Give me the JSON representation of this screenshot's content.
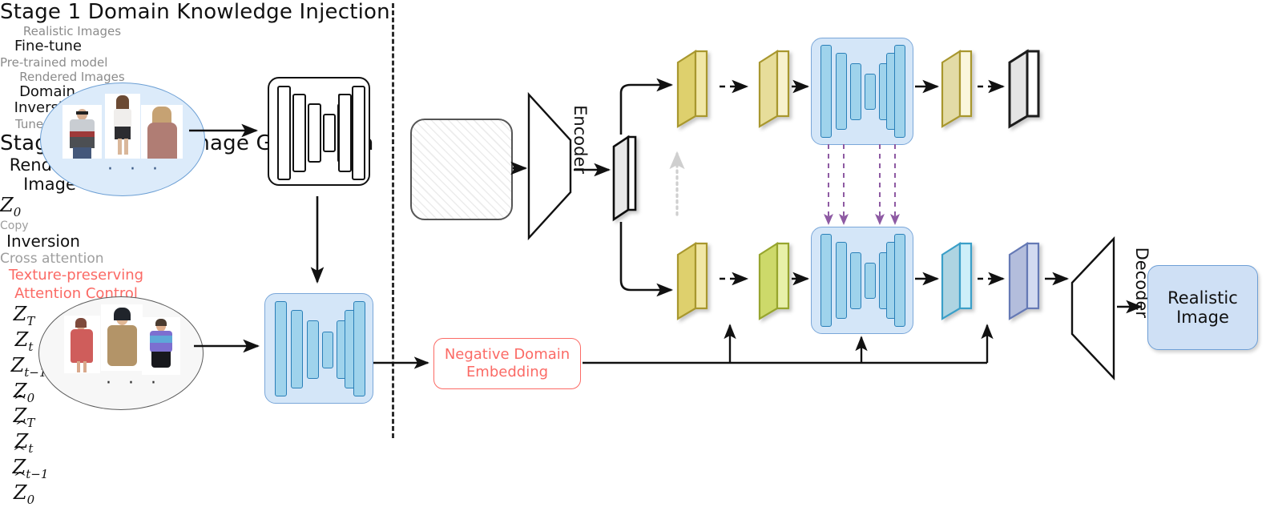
{
  "stages": {
    "stage1": {
      "title": "Stage 1 Domain Knowledge Injection",
      "source_caption": "Realistic Images",
      "source_dots": "· · ·",
      "arrow1_label": "Fine-tune",
      "model1_caption": "Pre-trained model",
      "arrow2_label_line1": "Domain",
      "arrow2_label_line2": "Inversion",
      "target_caption": "Rendered Images",
      "target_dots": "· · ·",
      "model2_caption": "Tuned model"
    },
    "stage2": {
      "title": "Stage 2 Realistic Image Generation",
      "input_box_line1": "Rendered",
      "input_box_line2": "Image",
      "encoder_label": "Encoder",
      "decoder_label": "Decoder",
      "latent_z0_label": "Z",
      "latent_z0_sub": "0",
      "copy_label": "Copy",
      "inversion_label": "Inversion",
      "negative_embedding_line1": "Negative Domain",
      "negative_embedding_line2": "Embedding",
      "cross_attention_label": "Cross attention",
      "attention_control_line1": "Texture-preserving",
      "attention_control_line2": "Attention Control",
      "output_box_line1": "Realistic",
      "output_box_line2": "Image"
    }
  },
  "top_chain": {
    "labels": [
      "Z_T",
      "Z_t",
      "Z_t-1",
      "Z_0"
    ],
    "items": [
      {
        "base": "Z",
        "sub": "T",
        "hat": false
      },
      {
        "base": "Z",
        "sub": "t",
        "hat": false
      },
      {
        "base": "Z",
        "sub": "t−1",
        "hat": false
      },
      {
        "base": "Z",
        "sub": "0",
        "hat": false
      }
    ]
  },
  "bottom_chain": {
    "labels": [
      "Ẑ_T",
      "Ẑ_t",
      "Ẑ_t-1",
      "Ẑ_0"
    ],
    "items": [
      {
        "base": "Z",
        "sub": "T",
        "hat": true
      },
      {
        "base": "Z",
        "sub": "t",
        "hat": true
      },
      {
        "base": "Z",
        "sub": "t−1",
        "hat": true
      },
      {
        "base": "Z",
        "sub": "0",
        "hat": true
      }
    ]
  },
  "colors": {
    "accent_red": "#fb6a65",
    "grey_caption": "#9e9e9e",
    "unet_blue_fill": "#d4e6f8",
    "unet_blue_bar": "#9fd3ec",
    "latent_yellow": "#e3d06a",
    "latent_pale_yellow": "#efe6a8",
    "latent_olive": "#d7e36a",
    "latent_cyan": "#a8d8e8",
    "latent_lavender": "#b4bede",
    "latent_grey": "#e2e2e2",
    "attention_purple": "#9a5fa8",
    "ellipse_blue": "#dcebfa",
    "ellipse_grey": "#f7f7f7"
  }
}
